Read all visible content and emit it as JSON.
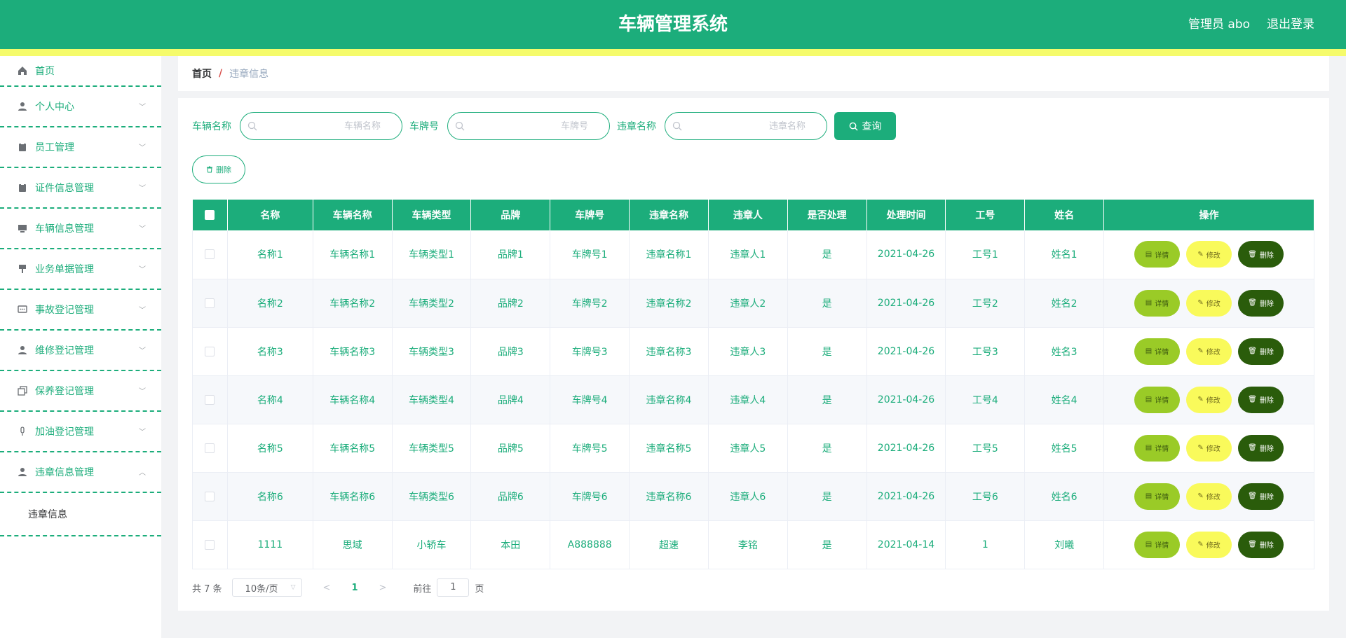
{
  "header": {
    "title": "车辆管理系统",
    "user": "管理员 abo",
    "logout": "退出登录"
  },
  "colors": {
    "primary": "#1cad7b",
    "yellow_bar": "#f5fb6b",
    "detail": "#9acb27",
    "edit": "#f9fa5b",
    "remove": "#2a5c0b"
  },
  "sidebar": {
    "items": [
      {
        "label": "首页",
        "icon": "home-icon"
      },
      {
        "label": "个人中心",
        "icon": "user-icon"
      },
      {
        "label": "员工管理",
        "icon": "clipboard-icon"
      },
      {
        "label": "证件信息管理",
        "icon": "clipboard-icon"
      },
      {
        "label": "车辆信息管理",
        "icon": "monitor-icon"
      },
      {
        "label": "业务单据管理",
        "icon": "stamp-icon"
      },
      {
        "label": "事故登记管理",
        "icon": "chat-icon"
      },
      {
        "label": "维修登记管理",
        "icon": "user-icon"
      },
      {
        "label": "保养登记管理",
        "icon": "copy-icon"
      },
      {
        "label": "加油登记管理",
        "icon": "mic-icon"
      },
      {
        "label": "违章信息管理",
        "icon": "user-icon"
      }
    ],
    "submenu": "违章信息"
  },
  "breadcrumb": {
    "home": "首页",
    "separator": "/",
    "current": "违章信息"
  },
  "search": {
    "fields": [
      {
        "label": "车辆名称",
        "placeholder": "车辆名称"
      },
      {
        "label": "车牌号",
        "placeholder": "车牌号"
      },
      {
        "label": "违章名称",
        "placeholder": "违章名称"
      }
    ],
    "query_label": "查询"
  },
  "actions": {
    "delete_label": "删除"
  },
  "table": {
    "columns": [
      "名称",
      "车辆名称",
      "车辆类型",
      "品牌",
      "车牌号",
      "违章名称",
      "违章人",
      "是否处理",
      "处理时间",
      "工号",
      "姓名",
      "操作"
    ],
    "rows": [
      [
        "名称1",
        "车辆名称1",
        "车辆类型1",
        "品牌1",
        "车牌号1",
        "违章名称1",
        "违章人1",
        "是",
        "2021-04-26",
        "工号1",
        "姓名1"
      ],
      [
        "名称2",
        "车辆名称2",
        "车辆类型2",
        "品牌2",
        "车牌号2",
        "违章名称2",
        "违章人2",
        "是",
        "2021-04-26",
        "工号2",
        "姓名2"
      ],
      [
        "名称3",
        "车辆名称3",
        "车辆类型3",
        "品牌3",
        "车牌号3",
        "违章名称3",
        "违章人3",
        "是",
        "2021-04-26",
        "工号3",
        "姓名3"
      ],
      [
        "名称4",
        "车辆名称4",
        "车辆类型4",
        "品牌4",
        "车牌号4",
        "违章名称4",
        "违章人4",
        "是",
        "2021-04-26",
        "工号4",
        "姓名4"
      ],
      [
        "名称5",
        "车辆名称5",
        "车辆类型5",
        "品牌5",
        "车牌号5",
        "违章名称5",
        "违章人5",
        "是",
        "2021-04-26",
        "工号5",
        "姓名5"
      ],
      [
        "名称6",
        "车辆名称6",
        "车辆类型6",
        "品牌6",
        "车牌号6",
        "违章名称6",
        "违章人6",
        "是",
        "2021-04-26",
        "工号6",
        "姓名6"
      ],
      [
        "1111",
        "思域",
        "小轿车",
        "本田",
        "A888888",
        "超速",
        "李铭",
        "是",
        "2021-04-14",
        "1",
        "刘曦"
      ]
    ],
    "ops": {
      "detail": "详情",
      "edit": "修改",
      "remove": "删除"
    }
  },
  "pagination": {
    "total": "共 7 条",
    "page_size": "10条/页",
    "current_page": "1",
    "goto_prefix": "前往",
    "goto_value": "1",
    "goto_suffix": "页"
  }
}
